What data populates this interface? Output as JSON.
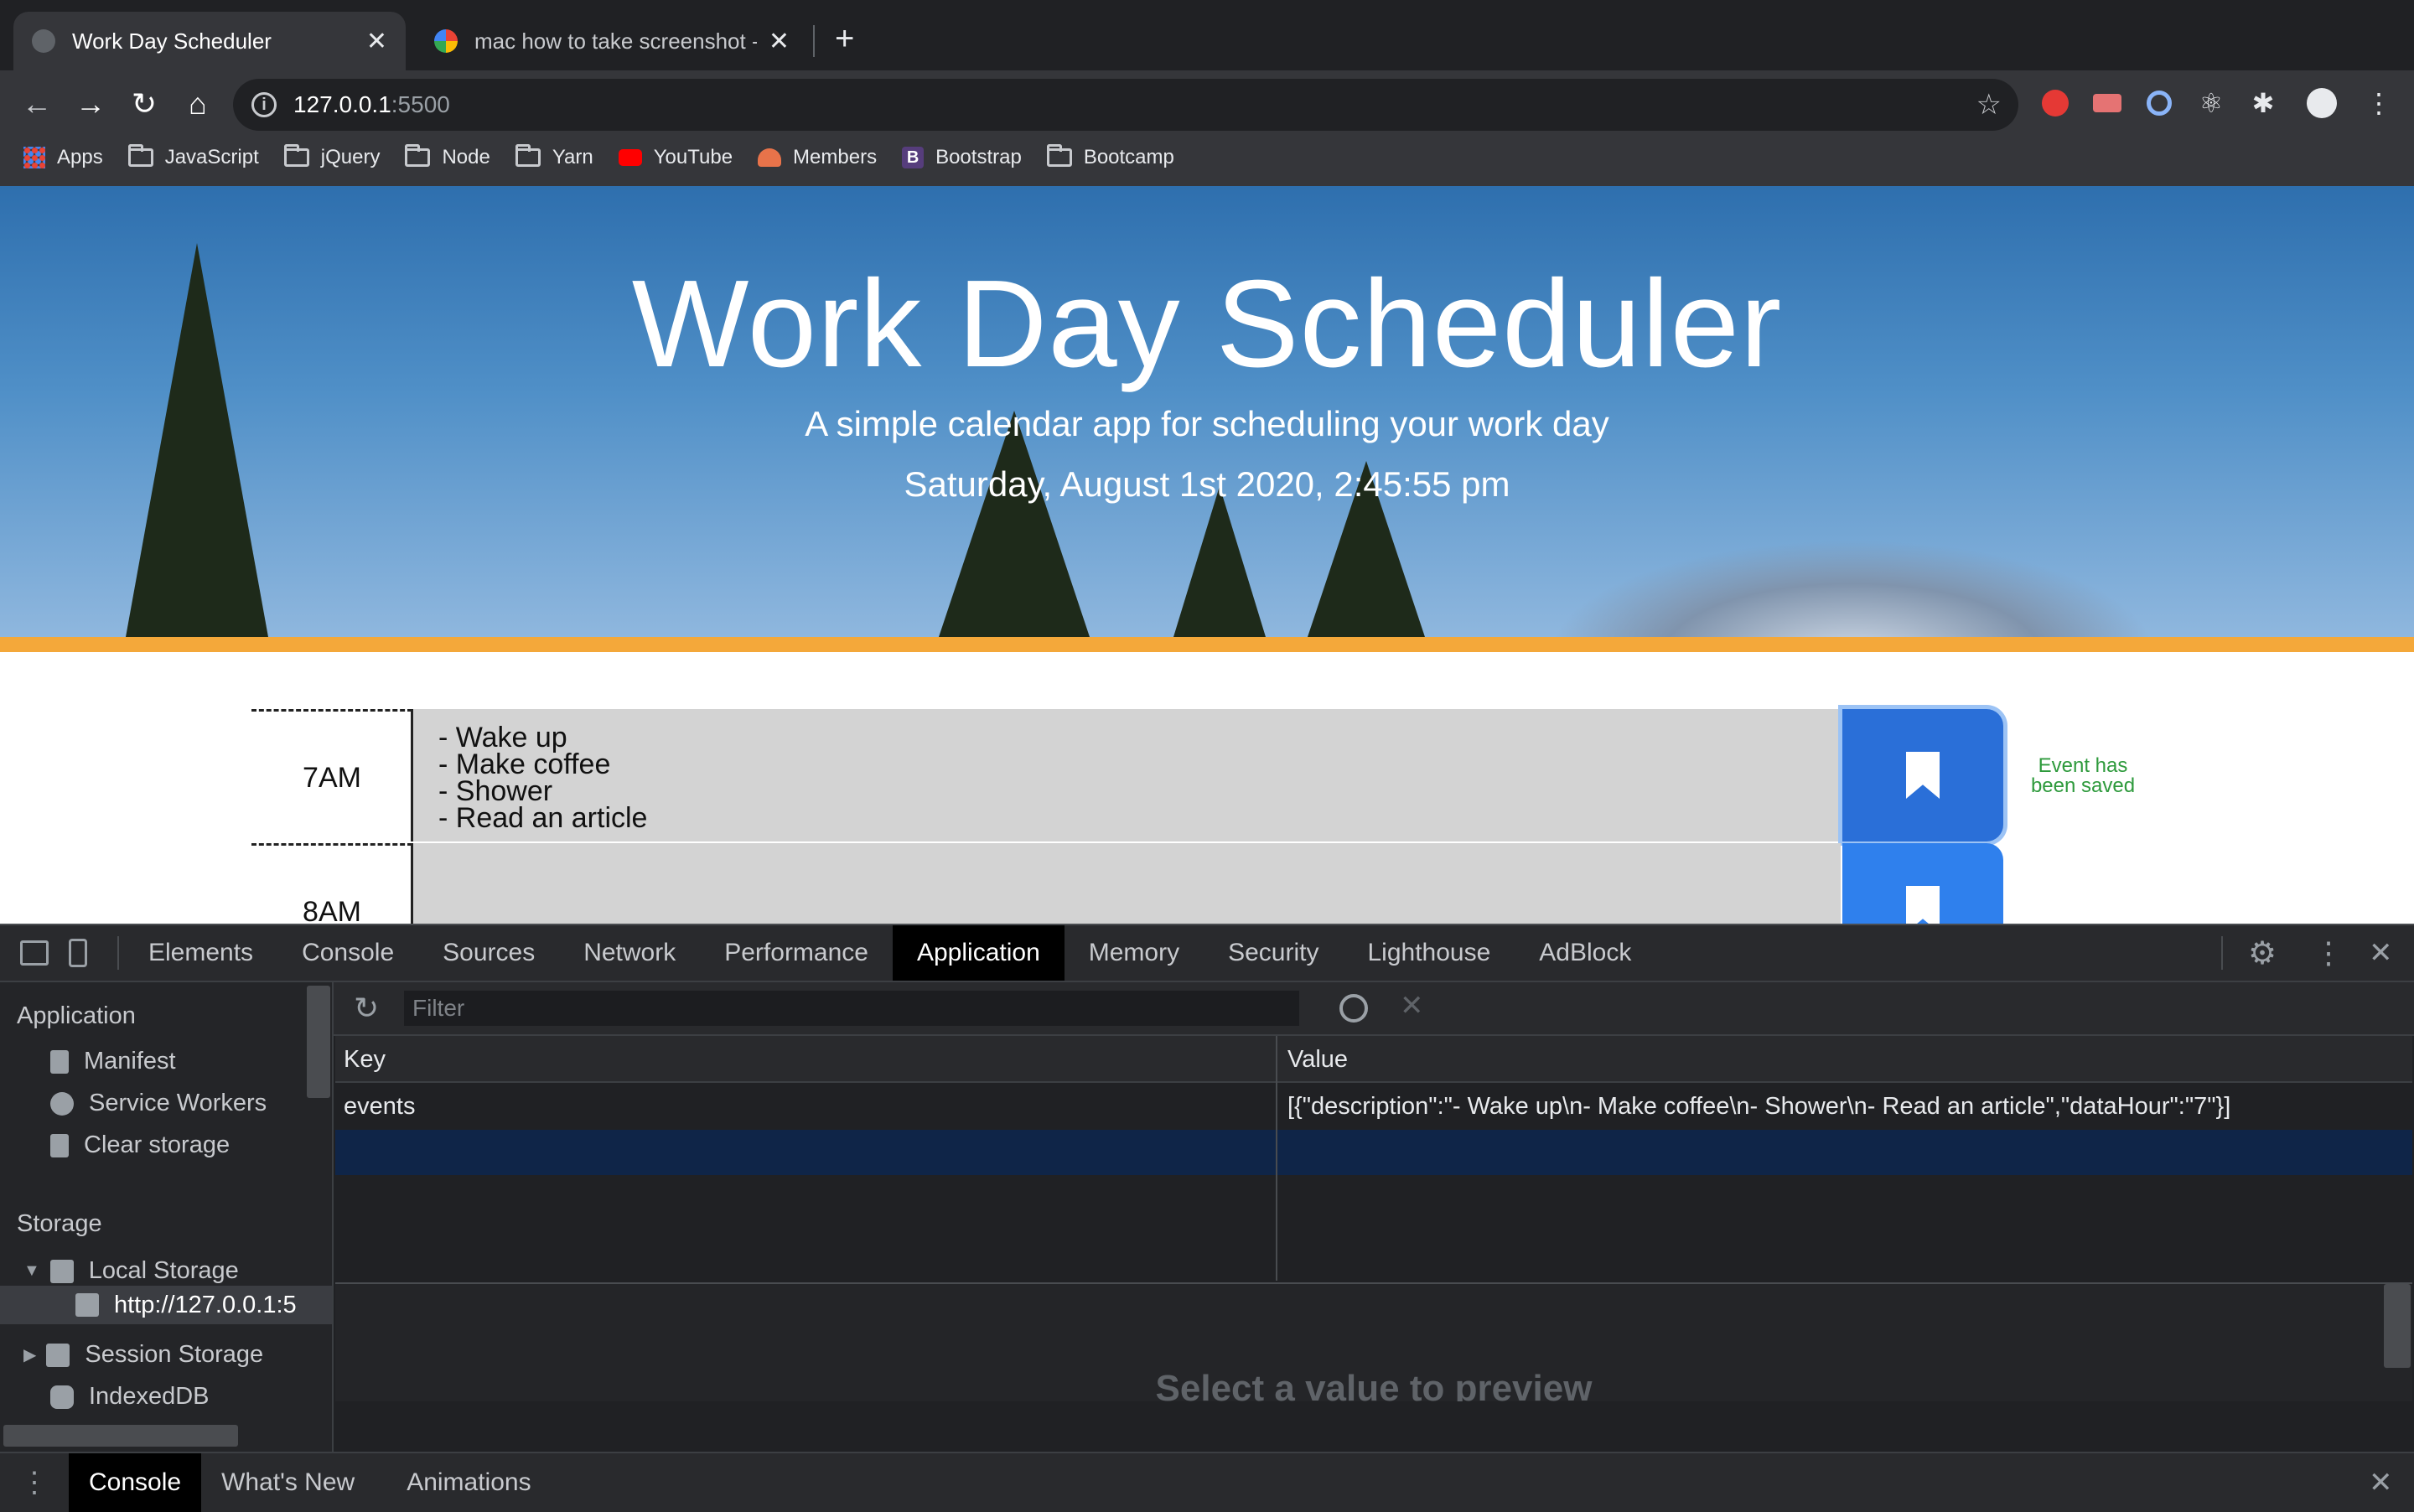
{
  "browser": {
    "tabs": [
      {
        "title": "Work Day Scheduler",
        "active": true
      },
      {
        "title": "mac how to take screenshot - G",
        "active": false
      }
    ],
    "new_tab_glyph": "+",
    "url": {
      "host": "127.0.0.1",
      "port": ":5500"
    },
    "bookmarks": [
      {
        "label": "Apps",
        "icon": "apps-grid-icon"
      },
      {
        "label": "JavaScript",
        "icon": "folder-icon"
      },
      {
        "label": "jQuery",
        "icon": "folder-icon"
      },
      {
        "label": "Node",
        "icon": "folder-icon"
      },
      {
        "label": "Yarn",
        "icon": "folder-icon"
      },
      {
        "label": "YouTube",
        "icon": "youtube-icon"
      },
      {
        "label": "Members",
        "icon": "members-icon"
      },
      {
        "label": "Bootstrap",
        "icon": "bootstrap-icon"
      },
      {
        "label": "Bootcamp",
        "icon": "folder-icon"
      }
    ]
  },
  "page": {
    "title": "Work Day Scheduler",
    "subtitle": "A simple calendar app for scheduling your work day",
    "current_datetime": "Saturday, August 1st 2020, 2:45:55 pm",
    "time_blocks": [
      {
        "hour": "7AM",
        "description": "- Wake up\n- Make coffee\n- Shower\n- Read an article"
      },
      {
        "hour": "8AM",
        "description": ""
      }
    ],
    "saved_message": "Event has\nbeen saved",
    "colors": {
      "accent_bar": "#f4a83a",
      "save_button": "#2a6fd8",
      "time_block_bg": "#d3d3d3",
      "saved_text": "#2e9a3c"
    }
  },
  "devtools": {
    "tabs": [
      "Elements",
      "Console",
      "Sources",
      "Network",
      "Performance",
      "Application",
      "Memory",
      "Security",
      "Lighthouse",
      "AdBlock"
    ],
    "active_tab": "Application",
    "sidebar": {
      "application_header": "Application",
      "application_items": [
        "Manifest",
        "Service Workers",
        "Clear storage"
      ],
      "storage_header": "Storage",
      "local_storage": "Local Storage",
      "local_storage_origin": "http://127.0.0.1:5",
      "session_storage": "Session Storage",
      "indexeddb": "IndexedDB"
    },
    "filter_placeholder": "Filter",
    "table": {
      "headers": {
        "key": "Key",
        "value": "Value"
      },
      "rows": [
        {
          "key": "events",
          "value": "[{\"description\":\"- Wake up\\n- Make coffee\\n- Shower\\n- Read an article\",\"dataHour\":\"7\"}]"
        }
      ]
    },
    "preview_text": "Select a value to preview",
    "drawer_tabs": [
      "Console",
      "What's New",
      "Animations"
    ]
  }
}
